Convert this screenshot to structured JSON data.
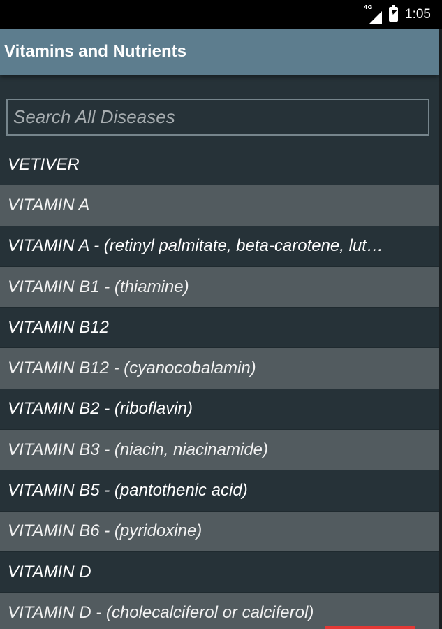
{
  "status_bar": {
    "network_type": "4G",
    "time": "1:05",
    "signal_icon": "signal-icon",
    "battery_icon": "battery-charging-icon"
  },
  "app_bar": {
    "title": "Vitamins and Nutrients"
  },
  "search": {
    "placeholder": "Search All Diseases",
    "value": ""
  },
  "list": {
    "items": [
      {
        "label": "VETIVER"
      },
      {
        "label": "VITAMIN A"
      },
      {
        "label": "VITAMIN A - (retinyl palmitate, beta-carotene, lut…"
      },
      {
        "label": "VITAMIN B1 - (thiamine)"
      },
      {
        "label": "VITAMIN B12"
      },
      {
        "label": "VITAMIN B12 - (cyanocobalamin)"
      },
      {
        "label": "VITAMIN B2 - (riboflavin)"
      },
      {
        "label": "VITAMIN B3 - (niacin, niacinamide)"
      },
      {
        "label": "VITAMIN B5 - (pantothenic acid)"
      },
      {
        "label": "VITAMIN B6 - (pyridoxine)"
      },
      {
        "label": "VITAMIN D"
      },
      {
        "label": "VITAMIN D - (cholecalciferol or calciferol)"
      }
    ]
  },
  "colors": {
    "app_bar": "#5d7d8e",
    "background": "#263238",
    "row_alt": "#525b5f",
    "accent": "#e53935"
  }
}
